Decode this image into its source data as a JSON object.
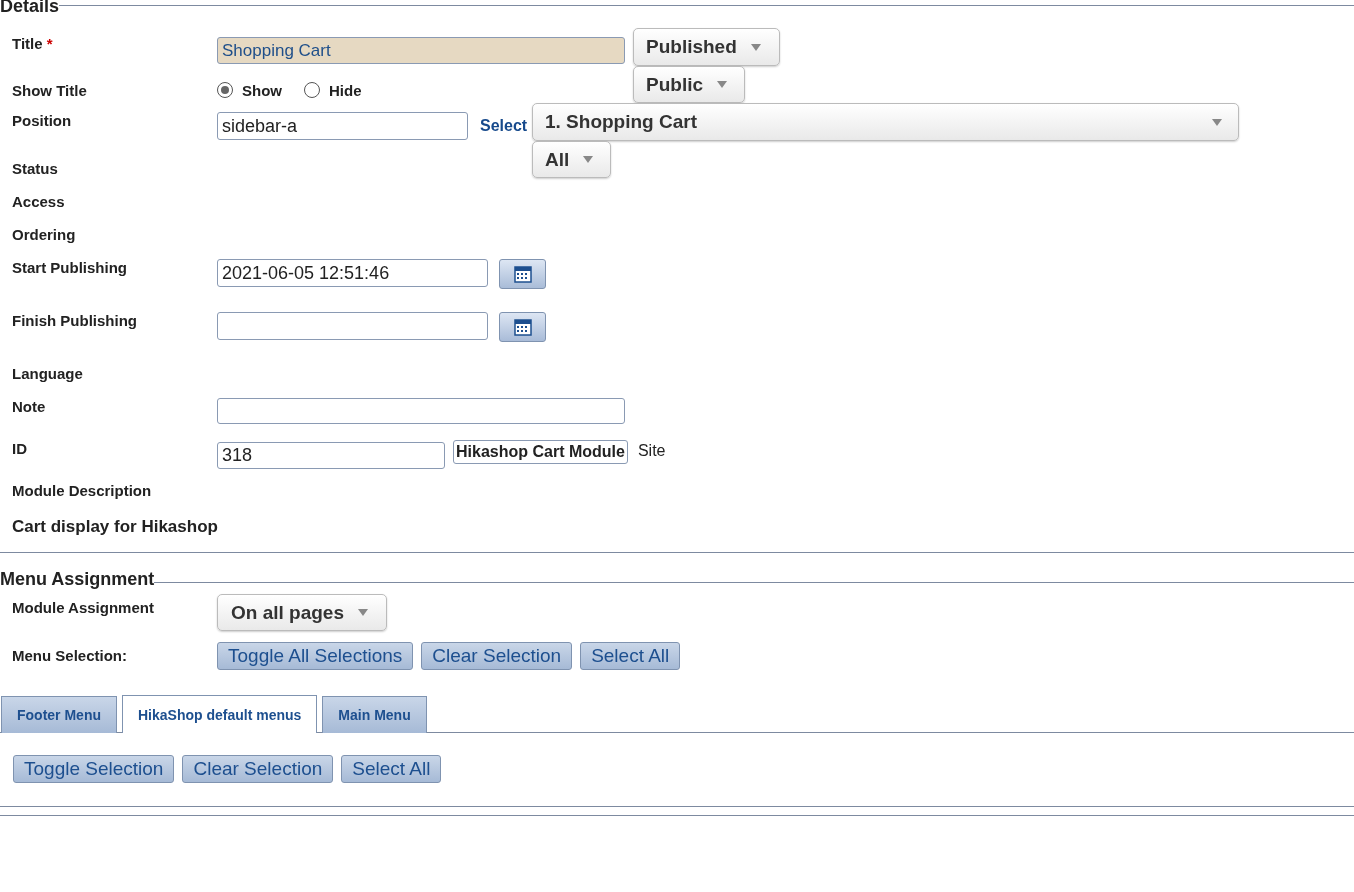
{
  "details": {
    "legend": "Details",
    "title": {
      "label": "Title",
      "required_mark": "*",
      "value": "Shopping Cart"
    },
    "show_title": {
      "label": "Show Title",
      "options": [
        {
          "label": "Show",
          "selected": true
        },
        {
          "label": "Hide",
          "selected": false
        }
      ]
    },
    "position": {
      "label": "Position",
      "value": "sidebar-a",
      "link": "Select"
    },
    "status": {
      "label": "Status",
      "value": "Published"
    },
    "access": {
      "label": "Access",
      "value": "Public"
    },
    "ordering": {
      "label": "Ordering",
      "value": "1. Shopping Cart"
    },
    "start_publishing": {
      "label": "Start Publishing",
      "value": "2021-06-05 12:51:46"
    },
    "finish_publishing": {
      "label": "Finish Publishing"
    },
    "language": {
      "label": "Language",
      "value": "All"
    },
    "note": {
      "label": "Note"
    },
    "id": {
      "label": "ID",
      "value": "318",
      "module_name": "Hikashop Cart Module",
      "client": "Site"
    },
    "module_description": {
      "label": "Module Description",
      "text": "Cart display for Hikashop"
    }
  },
  "menu_assignment": {
    "legend": "Menu Assignment",
    "module_assignment": {
      "label": "Module Assignment",
      "value": "On all pages"
    },
    "menu_selection": {
      "label": "Menu Selection:",
      "buttons": [
        "Toggle All Selections",
        "Clear Selection",
        "Select All"
      ]
    },
    "tabs": [
      {
        "label": "Footer Menu",
        "selected": false
      },
      {
        "label": "HikaShop default menus",
        "selected": true
      },
      {
        "label": "Main Menu",
        "selected": false
      }
    ],
    "buttons": [
      "Toggle Selection",
      "Clear Selection",
      "Select All"
    ]
  }
}
